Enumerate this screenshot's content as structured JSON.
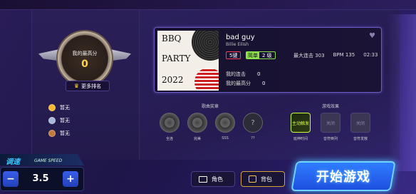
{
  "rank": {
    "label": "我的最高分",
    "score": "0",
    "more_label": "更多排名"
  },
  "medals": [
    {
      "color": "#f5b82e",
      "text": "暂无"
    },
    {
      "color": "#a9b8d6",
      "text": "暂无"
    },
    {
      "color": "#c27a3c",
      "text": "暂无"
    }
  ],
  "song": {
    "cover_lines": [
      "BBQ",
      "PARTY",
      "2022"
    ],
    "title": "bad guy",
    "artist": "Billie Eilish",
    "keys": "5键",
    "difficulty_name": "简单",
    "difficulty_level": "2 级",
    "max_combo_label": "最大连击 303",
    "bpm_label": "BPM 135",
    "duration": "02:33",
    "my_combo_label": "我的连击",
    "my_combo_value": "0",
    "my_best_label": "我的最高分",
    "my_best_value": "0"
  },
  "awards": {
    "title": "歌曲奖章",
    "items": [
      {
        "label": "全连",
        "icon": "record-icon"
      },
      {
        "label": "完美",
        "icon": "record-icon"
      },
      {
        "label": "SSS",
        "icon": "record-icon"
      },
      {
        "label": "??",
        "icon": "question-icon"
      }
    ]
  },
  "effects": {
    "title": "游戏效果",
    "items": [
      {
        "label": "延伸时间",
        "icon_text": "主动触发",
        "active": true
      },
      {
        "label": "音符倒列",
        "icon_text": "关闭",
        "active": false
      },
      {
        "label": "音符发散",
        "icon_text": "关闭",
        "active": false
      }
    ]
  },
  "speed": {
    "title_cn": "调速",
    "title_en": "GAME SPEED",
    "value": "3.5",
    "minus": "−",
    "plus": "+"
  },
  "buttons": {
    "role": "角色",
    "bag": "背包",
    "start": "开始游戏"
  },
  "colors": {
    "accent": "#2f7dff",
    "gold": "#ffd24a"
  }
}
